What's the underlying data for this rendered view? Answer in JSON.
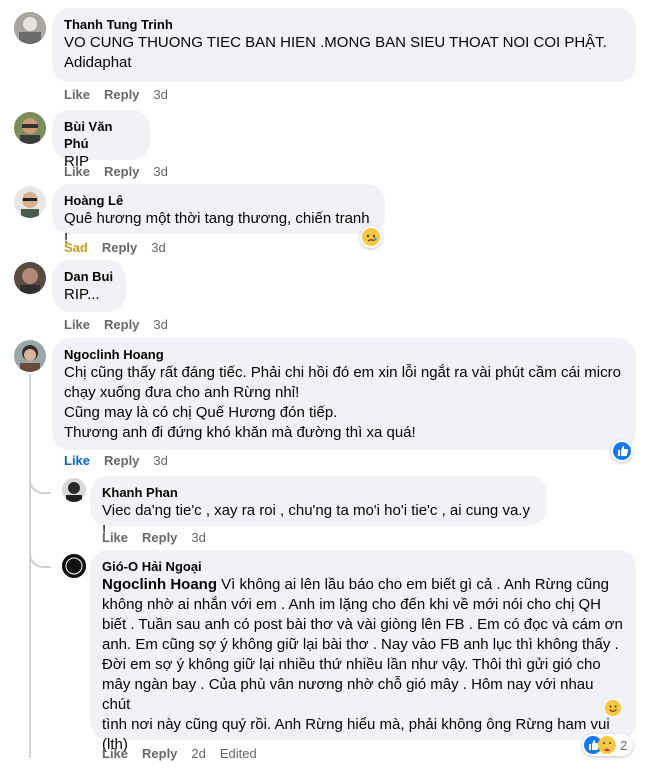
{
  "comments": [
    {
      "author": "Thanh Tung Trinh",
      "text": "VO CUNG THUONG TIEC BAN HIEN .MONG BAN SIEU THOAT NOI COI PHẬT.\nAdidaphat",
      "like": "Like",
      "reply": "Reply",
      "time": "3d"
    },
    {
      "author": "Bùi Văn Phú",
      "text": "RIP",
      "like": "Like",
      "reply": "Reply",
      "time": "3d"
    },
    {
      "author": "Hoàng Lê",
      "text": "Quê hương một thời tang thương, chiến tranh !",
      "like": "Sad",
      "reply": "Reply",
      "time": "3d"
    },
    {
      "author": "Dan Bui",
      "text": "RIP...",
      "like": "Like",
      "reply": "Reply",
      "time": "3d"
    },
    {
      "author": "Ngoclinh Hoang",
      "text": "Chị cũng thấy rất đáng tiếc. Phải chi hồi đó em xin lỗi ngắt ra vài phút cầm cái micro\nchạy xuống đưa cho anh Rừng nhỉ!\nCũng may là có chị Quế Hương đón tiếp.\nThương anh đi đứng khó khăn mà đường thì xa quá!",
      "like": "Like",
      "reply": "Reply",
      "time": "3d"
    }
  ],
  "replies": [
    {
      "author": "Khanh Phan",
      "text": "Viec da'ng tie'c , xay ra roi , chu'ng ta mo'i ho'i tie'c , ai cung va.y !",
      "like": "Like",
      "reply": "Reply",
      "time": "3d"
    },
    {
      "author": "Gió-O Hải Ngoại",
      "mention": "Ngoclinh Hoang",
      "text": " Vì không ai lên lầu báo cho em biết gì cả . Anh Rừng cũng\nkhông nhờ ai nhắn với em . Anh im lặng cho đến khi về mới nói cho chị QH\nbiết . Tuần sau anh có post bài thơ và vài giòng lên FB . Em có đọc và cám ơn\nanh. Em cũng sợ ý không giữ lại bài thơ . Nay vào FB anh lục thì không thấy .\nĐời em sợ ý không giữ lại nhiều thứ nhiều lần như vậy. Thôi thì gửi gió cho\nmây ngàn bay . Của phù vân nương nhờ chỗ gió mây . Hôm nay với nhau chút\ntình nơi này cũng quý rồi. Anh Rừng hiểu mà, phải không ông Rừng ham vui\n(lth)",
      "like": "Like",
      "reply": "Reply",
      "time": "2d",
      "edited": "Edited",
      "reaction_count": "2"
    }
  ],
  "avatar_text": "gio\no",
  "colors": {
    "bubble": "#f0f2f5",
    "meta": "#65676b",
    "like_blue": "#0a66c2",
    "sad_yellow": "#c6a016"
  }
}
